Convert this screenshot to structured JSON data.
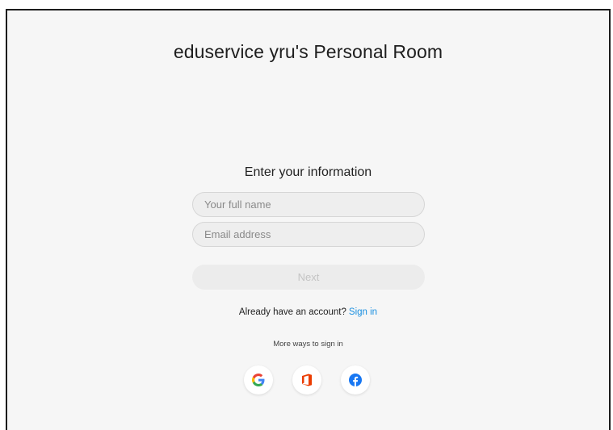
{
  "room": {
    "title": "eduservice yru's Personal Room"
  },
  "form": {
    "title": "Enter your information",
    "name_placeholder": "Your full name",
    "email_placeholder": "Email address",
    "next_label": "Next"
  },
  "account": {
    "prompt": "Already have an account?",
    "signin_label": "Sign in"
  },
  "more_ways": {
    "label": "More ways to sign in"
  },
  "social_buttons": [
    {
      "icon": "google-icon",
      "color": "#4285F4"
    },
    {
      "icon": "office-icon",
      "color": "#EB3C00"
    },
    {
      "icon": "facebook-icon",
      "color": "#1877F2"
    }
  ]
}
